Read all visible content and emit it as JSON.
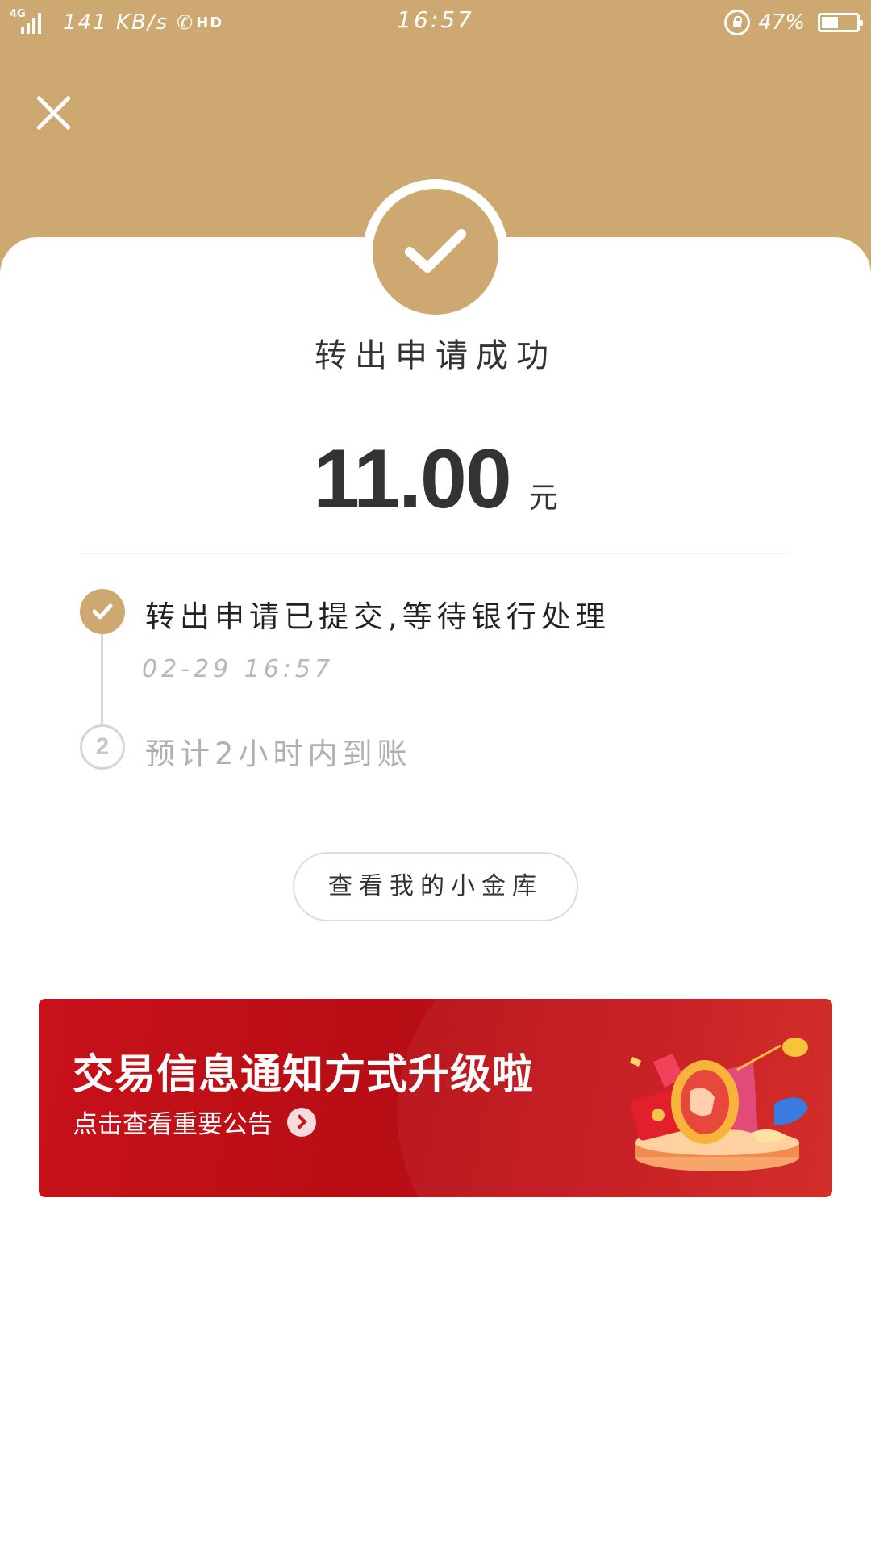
{
  "status_bar": {
    "network": "4G",
    "speed": "141 KB/s",
    "call_badge": "HD",
    "time": "16:57",
    "battery": "47%",
    "battery_level": 0.47
  },
  "colors": {
    "accent": "#cda870",
    "banner_red": "#c3141b"
  },
  "result": {
    "title": "转出申请成功",
    "amount": "11.00",
    "unit": "元"
  },
  "steps": [
    {
      "number": "1",
      "text": "转出申请已提交,等待银行处理",
      "time": "02-29 16:57",
      "done": true
    },
    {
      "number": "2",
      "text": "预计2小时内到账",
      "done": false
    }
  ],
  "actions": {
    "view_vault": "查看我的小金库"
  },
  "banner": {
    "title": "交易信息通知方式升级啦",
    "subtitle": "点击查看重要公告"
  },
  "icons": [
    "close-icon",
    "checkmark-icon",
    "chevron-right-icon",
    "megaphone-icon",
    "lock-rotation-icon",
    "battery-icon",
    "signal-icon",
    "phone-icon"
  ]
}
